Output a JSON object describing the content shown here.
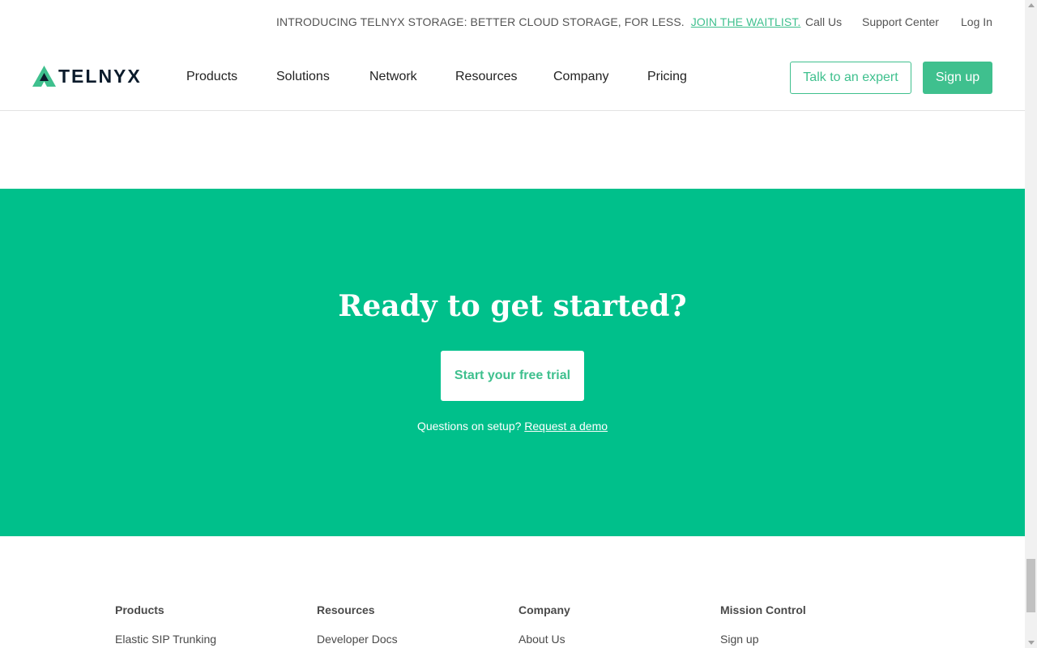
{
  "announcement": {
    "text": "INTRODUCING TELNYX STORAGE: BETTER CLOUD STORAGE, FOR LESS.",
    "link": "JOIN THE WAITLIST."
  },
  "utility_nav": {
    "call_us": "Call Us",
    "support_center": "Support Center",
    "log_in": "Log In"
  },
  "header": {
    "logo_text": "TELNYX",
    "nav": [
      "Products",
      "Solutions",
      "Network",
      "Resources",
      "Company",
      "Pricing"
    ],
    "talk_to_expert": "Talk to an expert",
    "sign_up": "Sign up"
  },
  "cta": {
    "title": "Ready to get started?",
    "button": "Start your free trial",
    "question": "Questions on setup?",
    "demo_link": "Request a demo"
  },
  "footer": {
    "columns": [
      {
        "heading": "Products",
        "first_link": "Elastic SIP Trunking"
      },
      {
        "heading": "Resources",
        "first_link": "Developer Docs"
      },
      {
        "heading": "Company",
        "first_link": "About Us"
      },
      {
        "heading": "Mission Control",
        "first_link": "Sign up"
      }
    ]
  },
  "colors": {
    "brand_green": "#00c08b",
    "accent_green": "#3fc08e",
    "logo_dark": "#0b1b2b"
  },
  "icons": {
    "logo_mark": "telnyx-logo-icon"
  }
}
